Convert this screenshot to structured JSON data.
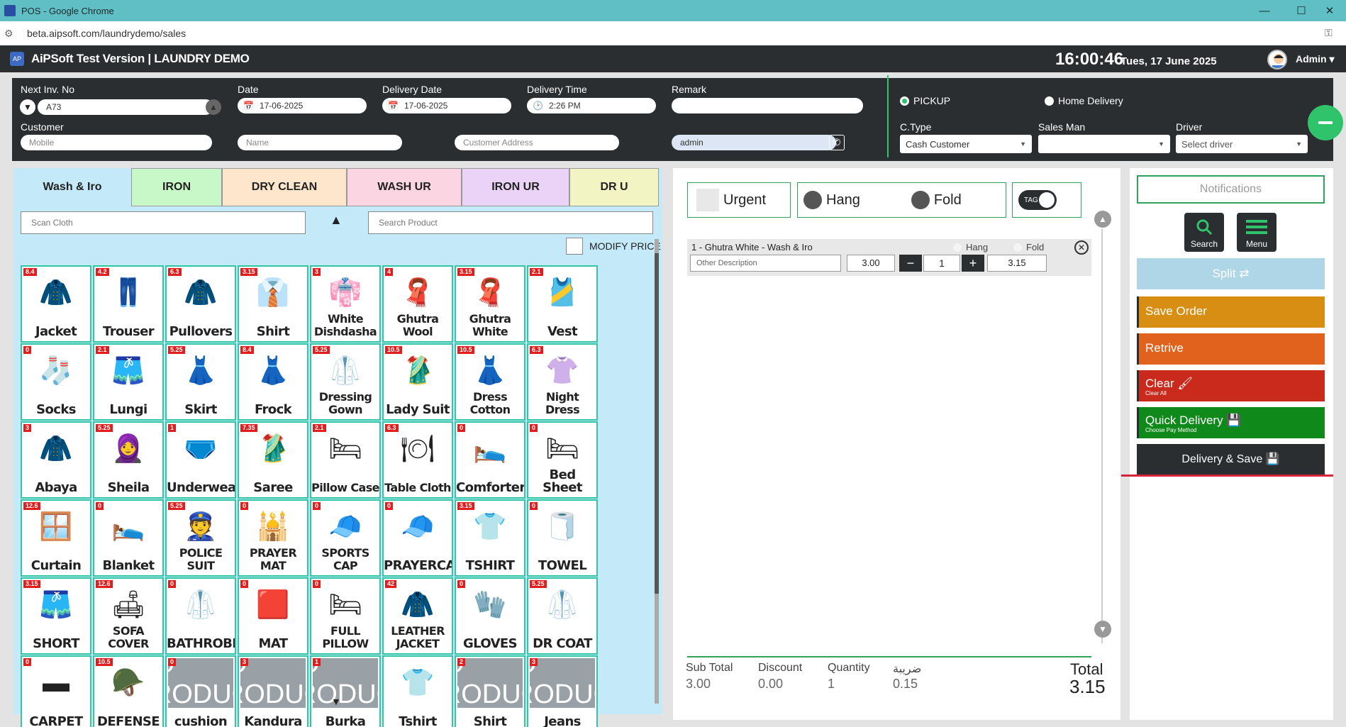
{
  "browser": {
    "title": "POS - Google Chrome",
    "url": "beta.aipsoft.com/laundrydemo/sales"
  },
  "header": {
    "app_title": "AiPSoft Test Version | LAUNDRY DEMO",
    "time": "16:00:46",
    "date": "Tues, 17 June 2025",
    "user": "Admin"
  },
  "form": {
    "inv_label": "Next Inv. No",
    "inv_value": "A73",
    "date_label": "Date",
    "date_value": "17-06-2025",
    "delivery_date_label": "Delivery Date",
    "delivery_date_value": "17-06-2025",
    "delivery_time_label": "Delivery Time",
    "delivery_time_value": "2:26 PM",
    "remark_label": "Remark",
    "remark_value": "",
    "customer_label": "Customer",
    "mobile_placeholder": "Mobile",
    "name_placeholder": "Name",
    "address_placeholder": "Customer Address",
    "user_value": "admin",
    "pickup_label": "PICKUP",
    "home_delivery_label": "Home Delivery",
    "ctype_label": "C.Type",
    "ctype_value": "Cash Customer",
    "salesman_label": "Sales Man",
    "salesman_value": "",
    "driver_label": "Driver",
    "driver_value": "Select driver"
  },
  "tabs": [
    {
      "label": "Wash & Iro",
      "color": "#c4e9f8"
    },
    {
      "label": "IRON",
      "color": "#c8f7c8"
    },
    {
      "label": "DRY CLEAN",
      "color": "#fde6cc"
    },
    {
      "label": "WASH UR",
      "color": "#fbd5e2"
    },
    {
      "label": "IRON UR",
      "color": "#ead3f7"
    },
    {
      "label": "DR U",
      "color": "#f3f4c4"
    }
  ],
  "search": {
    "scan_placeholder": "Scan Cloth",
    "product_placeholder": "Search Product",
    "modify_price": "MODIFY PRICE"
  },
  "products": [
    {
      "name": "Jacket",
      "price": "8.4",
      "icon": "🧥"
    },
    {
      "name": "Trouser",
      "price": "4.2",
      "icon": "👖"
    },
    {
      "name": "Pullovers",
      "price": "6.3",
      "icon": "🧥"
    },
    {
      "name": "Shirt",
      "price": "3.15",
      "icon": "👔"
    },
    {
      "name": "White Dishdasha",
      "price": "3",
      "icon": "👘"
    },
    {
      "name": "Ghutra Wool",
      "price": "4",
      "icon": "🧣"
    },
    {
      "name": "Ghutra White",
      "price": "3.15",
      "icon": "🧣"
    },
    {
      "name": "Vest",
      "price": "2.1",
      "icon": "🎽"
    },
    {
      "name": "Socks",
      "price": "0",
      "icon": "🧦"
    },
    {
      "name": "Lungi",
      "price": "2.1",
      "icon": "🩳"
    },
    {
      "name": "Skirt",
      "price": "5.25",
      "icon": "👗"
    },
    {
      "name": "Frock",
      "price": "8.4",
      "icon": "👗"
    },
    {
      "name": "Dressing Gown",
      "price": "5.25",
      "icon": "🥼"
    },
    {
      "name": "Lady Suit",
      "price": "10.5",
      "icon": "🥻"
    },
    {
      "name": "Dress Cotton",
      "price": "10.5",
      "icon": "👗"
    },
    {
      "name": "Night Dress",
      "price": "6.3",
      "icon": "👚"
    },
    {
      "name": "Abaya",
      "price": "3",
      "icon": "🧥"
    },
    {
      "name": "Sheila",
      "price": "5.25",
      "icon": "🧕"
    },
    {
      "name": "Underwear",
      "price": "1",
      "icon": "🩲"
    },
    {
      "name": "Saree",
      "price": "7.35",
      "icon": "🥻"
    },
    {
      "name": "Pillow Case",
      "price": "2.1",
      "icon": "🛏"
    },
    {
      "name": "Table Cloth",
      "price": "6.3",
      "icon": "🍽"
    },
    {
      "name": "Comforter",
      "price": "0",
      "icon": "🛌"
    },
    {
      "name": "Bed Sheet",
      "price": "0",
      "icon": "🛏"
    },
    {
      "name": "Curtain",
      "price": "12.6",
      "icon": "🪟"
    },
    {
      "name": "Blanket",
      "price": "0",
      "icon": "🛌"
    },
    {
      "name": "POLICE SUIT",
      "price": "5.25",
      "icon": "👮"
    },
    {
      "name": "PRAYER MAT",
      "price": "0",
      "icon": "🕌"
    },
    {
      "name": "SPORTS CAP",
      "price": "0",
      "icon": "🧢"
    },
    {
      "name": "PRAYERCAP",
      "price": "0",
      "icon": "🧢"
    },
    {
      "name": "TSHIRT",
      "price": "3.15",
      "icon": "👕"
    },
    {
      "name": "TOWEL",
      "price": "0",
      "icon": "🧻"
    },
    {
      "name": "SHORT",
      "price": "3.15",
      "icon": "🩳"
    },
    {
      "name": "SOFA COVER",
      "price": "12.6",
      "icon": "🛋"
    },
    {
      "name": "BATHROBE",
      "price": "0",
      "icon": "🥼"
    },
    {
      "name": "MAT",
      "price": "0",
      "icon": "🟥"
    },
    {
      "name": "FULL PILLOW",
      "price": "0",
      "icon": "🛏"
    },
    {
      "name": "LEATHER JACKET",
      "price": "42",
      "icon": "🧥"
    },
    {
      "name": "GLOVES",
      "price": "0",
      "icon": "🧤"
    },
    {
      "name": "DR COAT",
      "price": "5.25",
      "icon": "🥼"
    },
    {
      "name": "CARPET",
      "price": "0",
      "icon": "▬"
    },
    {
      "name": "DEFENSE",
      "price": "10.5",
      "icon": "🪖"
    },
    {
      "name": "cushion",
      "price": "0",
      "icon": "noimg"
    },
    {
      "name": "Kandura",
      "price": "3",
      "icon": "noimg"
    },
    {
      "name": "Burka",
      "price": "1",
      "icon": "noimg"
    },
    {
      "name": "Tshirt",
      "price": "",
      "icon": "👕"
    },
    {
      "name": "Shirt",
      "price": "2",
      "icon": "noimg"
    },
    {
      "name": "Jeans",
      "price": "3",
      "icon": "noimg"
    }
  ],
  "no_image_label": "NO PRODUCT IMAGE",
  "options": {
    "urgent": "Urgent",
    "hang": "Hang",
    "fold": "Fold",
    "tag": "TAG"
  },
  "cart": {
    "item_title": "1 - Ghutra White - Wash & Iro",
    "hang": "Hang",
    "fold": "Fold",
    "desc_placeholder": "Other Description",
    "price": "3.00",
    "qty": "1",
    "total": "3.15"
  },
  "totals": {
    "subtotal_label": "Sub Total",
    "subtotal": "3.00",
    "discount_label": "Discount",
    "discount": "0.00",
    "quantity_label": "Quantity",
    "quantity": "1",
    "tax_label": "ضريبة",
    "tax": "0.15",
    "total_label": "Total",
    "total": "3.15"
  },
  "actions": {
    "notifications": "Notifications",
    "search": "Search",
    "menu": "Menu",
    "split": "Split ⇄",
    "save_order": "Save Order",
    "retrive": "Retrive",
    "clear": "Clear",
    "clear_sub": "Clear All",
    "quick_delivery": "Quick Delivery",
    "quick_delivery_sub": "Choose Pay Method",
    "delivery_save": "Delivery & Save"
  },
  "colors": {
    "save_order": "#d88e12",
    "retrive": "#e0621c",
    "clear": "#c92a1c",
    "quick_delivery": "#0f8a1a",
    "delivery_save": "#2b2e31"
  }
}
